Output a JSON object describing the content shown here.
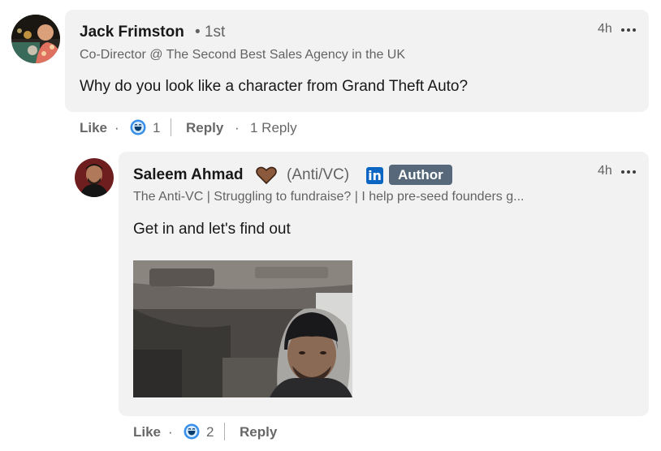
{
  "comment": {
    "author_name": "Jack Frimston",
    "degree": "• 1st",
    "headline": "Co-Director @ The Second Best Sales Agency in the UK",
    "text": "Why do you look like a character from Grand Theft Auto?",
    "time": "4h",
    "like_label": "Like",
    "reaction_count": "1",
    "reply_label": "Reply",
    "replies_count_label": "1 Reply"
  },
  "reply": {
    "author_name": "Saleem Ahmad",
    "pronoun_tag": "(Anti/VC)",
    "author_badge": "Author",
    "headline": "The Anti-VC | Struggling to fundraise? | I help pre-seed founders g...",
    "text": "Get in and let's find out",
    "time": "4h",
    "like_label": "Like",
    "reaction_count": "2",
    "reply_label": "Reply"
  },
  "icons": {
    "linkedin": "in",
    "reaction": "laugh-reaction",
    "heart": "brown-heart",
    "more": "more-options"
  },
  "colors": {
    "bubble_bg": "#f2f2f2",
    "badge_bg": "#56687a",
    "linkedin_blue": "#0a66c2",
    "heart": "#8b5a3c"
  }
}
